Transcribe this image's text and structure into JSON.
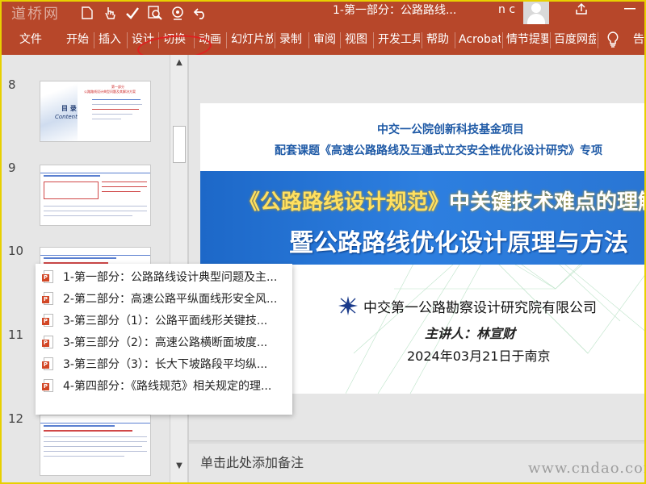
{
  "titlebar": {
    "document_title": "1-第一部分：公路路线...",
    "user_name": "n c",
    "quick_access_icons": [
      "file-new-icon",
      "touch-mode-icon",
      "spellcheck-icon",
      "find-icon",
      "record-icon",
      "undo-icon"
    ]
  },
  "watermarks": {
    "top_left": "道桥网",
    "bottom_right": "www.cndao.com"
  },
  "ribbon": {
    "tabs": [
      "文件",
      "开始",
      "插入",
      "设计",
      "切换",
      "动画",
      "幻灯片放",
      "录制",
      "审阅",
      "视图",
      "开发工具",
      "帮助",
      "Acrobat",
      "情节提要",
      "百度网盘",
      "告"
    ],
    "tell_me_icon": "lightbulb-icon"
  },
  "thumbnails": {
    "slide_numbers": [
      "8",
      "9",
      "10",
      "11",
      "12"
    ],
    "slide8": {
      "title": "第一部分",
      "heading": "公路路线设计典型问题及其解决方案",
      "toc_cn": "目 录",
      "toc_en": "Content"
    }
  },
  "popup_menu": {
    "items": [
      "1-第一部分：公路路线设计典型问题及主...",
      "2-第二部分：高速公路平纵面线形安全风...",
      "3-第三部分（1）：公路平面线形关键技...",
      "3-第三部分（2）：高速公路横断面坡度...",
      "3-第三部分（3）：长大下坡路段平均纵...",
      "4-第四部分：《路线规范》相关规定的理..."
    ]
  },
  "slide": {
    "project_line1": "中交一公院创新科技基金项目",
    "project_line2": "配套课题《高速公路路线及互通式立交安全性优化设计研究》专项",
    "banner_title1_prefix": "《公路路线设计规范》",
    "banner_title1_rest": "中关键技术难点的理解与",
    "banner_title2": "暨公路路线优化设计原理与方法",
    "organization": "中交第一公路勘察设计研究院有限公司",
    "speaker": "主讲人：林宣财",
    "date": "2024年03月21日于南京"
  },
  "notes": {
    "placeholder": "单击此处添加备注"
  },
  "colors": {
    "ribbon": "#b7472a",
    "banner": "#2d7fe0",
    "project_text": "#1f5aa6",
    "annotation": "#e02020"
  }
}
